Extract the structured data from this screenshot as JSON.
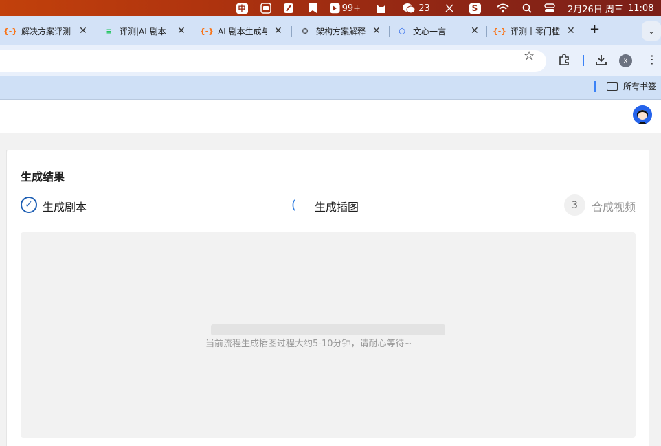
{
  "menubar": {
    "input_method": "中",
    "badge_count": "99+",
    "wechat_count": "23",
    "date": "2月26日 周三",
    "time": "11:08"
  },
  "tabs": [
    {
      "title": "解决方案评测",
      "favicon": "bracket-icon",
      "color": "#f97316"
    },
    {
      "title": "评测|AI 剧本",
      "favicon": "pen-lines-icon",
      "color": "#22c55e"
    },
    {
      "title": "AI 剧本生成与",
      "favicon": "bracket-icon",
      "color": "#f97316"
    },
    {
      "title": "架构方案解释",
      "favicon": "openai-icon",
      "color": "#333333"
    },
    {
      "title": "文心一言",
      "favicon": "wenxin-icon",
      "color": "#2563eb"
    },
    {
      "title": "评测丨零门槛",
      "favicon": "bracket-icon",
      "color": "#f97316"
    }
  ],
  "bookmarks": {
    "all_label": "所有书签"
  },
  "profile_initial": "x",
  "card": {
    "title": "生成结果",
    "steps": [
      {
        "label": "生成剧本",
        "status": "done"
      },
      {
        "label": "生成插图",
        "status": "in-progress"
      },
      {
        "label": "合成视频",
        "status": "pending",
        "number": "3"
      }
    ],
    "wait_message": "当前流程生成插图过程大约5-10分钟，请耐心等待~",
    "progress": 0
  },
  "colors": {
    "accent": "#1e5fb4",
    "menubar": "#9a2a12",
    "tabstrip": "#d3e2f7"
  }
}
